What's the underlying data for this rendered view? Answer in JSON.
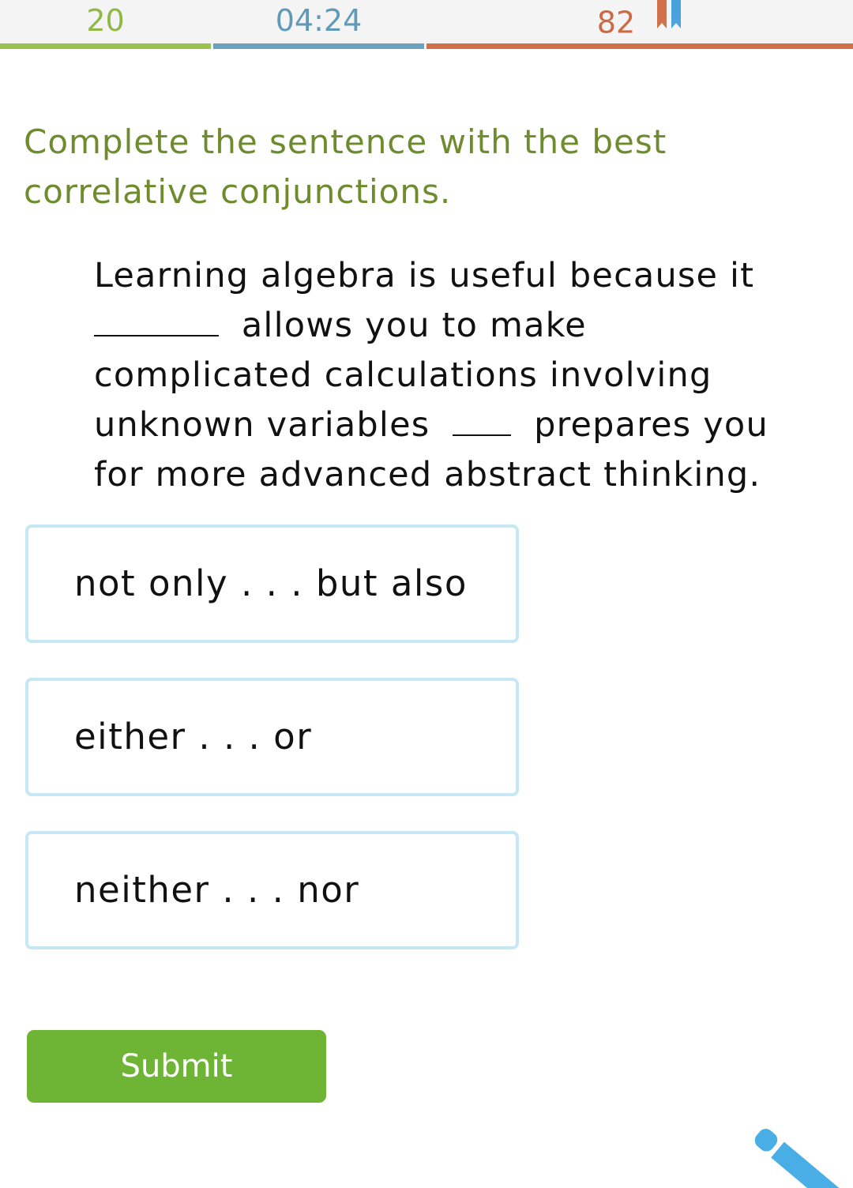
{
  "stats": {
    "questions_answered": "20",
    "time_elapsed": "04:24",
    "smart_score": "82",
    "colors": {
      "questions": "#9bc24c",
      "time": "#6ba1be",
      "score": "#d0714b"
    },
    "score_icon": "bookmark-ribbon-icon"
  },
  "instruction": "Complete the sentence with the best correlative conjunctions.",
  "sentence": {
    "part_1": "Learning algebra is useful because it ",
    "part_2": "allows you to make complicated calculations involving unknown variables",
    "part_3": "prepares you for more advanced abstract thinking."
  },
  "options": [
    {
      "label": "not only . . . but also"
    },
    {
      "label": "either . . . or"
    },
    {
      "label": "neither . . . nor"
    }
  ],
  "submit_label": "Submit",
  "tools": {
    "pencil_icon": "pencil-icon",
    "pencil_color": "#4aaee6"
  }
}
